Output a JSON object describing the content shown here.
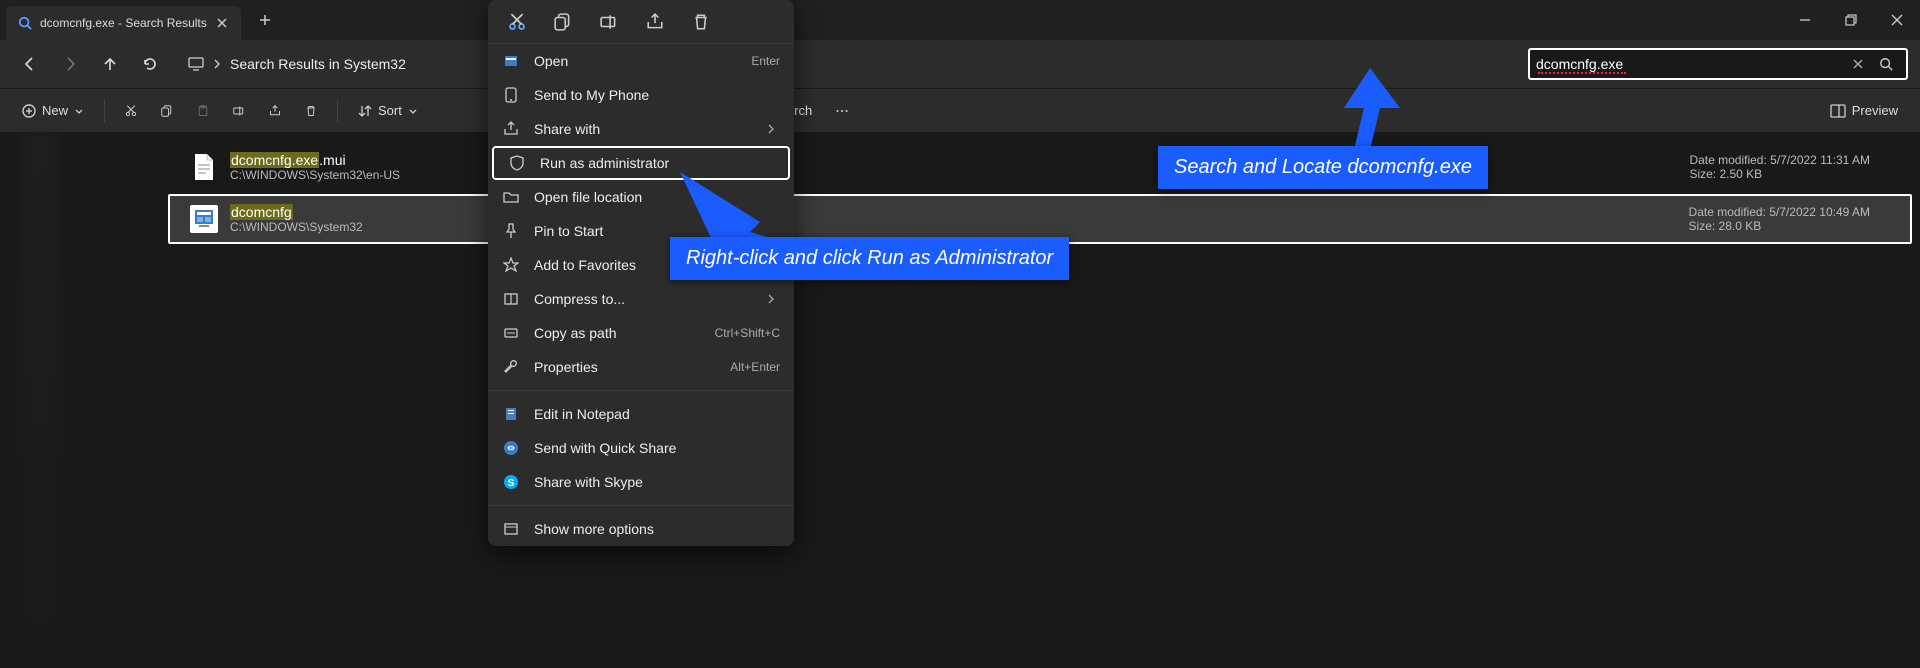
{
  "title": "dcomcnfg.exe - Search Results",
  "breadcrumb": "Search Results in System32",
  "search_value": "dcomcnfg.exe",
  "toolbar": {
    "new": "New",
    "sort": "Sort",
    "close_search": "se search",
    "preview": "Preview"
  },
  "results": [
    {
      "name_hl": "dcomcnfg.exe",
      "name_tail": ".mui",
      "path": "C:\\WINDOWS\\System32\\en-US",
      "date_label": "Date modified: 5/7/2022 11:31 AM",
      "size_label": "Size: 2.50 KB"
    },
    {
      "name_hl": "dcomcnfg",
      "name_tail": "",
      "path": "C:\\WINDOWS\\System32",
      "date_label": "Date modified: 5/7/2022 10:49 AM",
      "size_label": "Size: 28.0 KB"
    }
  ],
  "ctx": {
    "open": "Open",
    "open_hint": "Enter",
    "send_phone": "Send to My Phone",
    "share_with": "Share with",
    "run_admin": "Run as administrator",
    "open_loc": "Open file location",
    "pin_start": "Pin to Start",
    "add_fav": "Add to Favorites",
    "compress": "Compress to...",
    "copy_path": "Copy as path",
    "copy_path_hint": "Ctrl+Shift+C",
    "properties": "Properties",
    "properties_hint": "Alt+Enter",
    "edit_notepad": "Edit in Notepad",
    "quick_share": "Send with Quick Share",
    "skype": "Share with Skype",
    "more": "Show more options"
  },
  "annotation1": "Search and Locate dcomcnfg.exe",
  "annotation2": "Right-click and click Run as Administrator"
}
